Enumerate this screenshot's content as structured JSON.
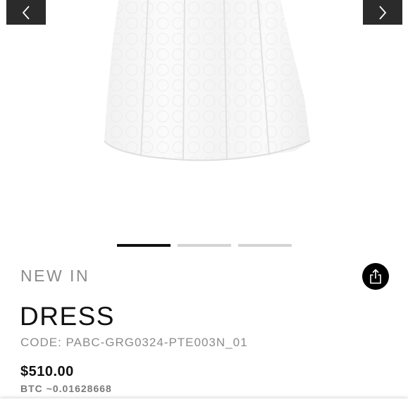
{
  "gallery": {
    "image_icon": "dress-product-image",
    "prev_icon": "chevron-left-icon",
    "next_icon": "chevron-right-icon",
    "slide_count": 3,
    "active_slide": 1
  },
  "product": {
    "badge": "NEW IN",
    "title": "DRESS",
    "code": "CODE: PABC-GRG0324-PTE003N_01",
    "price": "$510.00",
    "btc_price": "BTC ~0.01628668"
  },
  "share_icon": "share-icon"
}
